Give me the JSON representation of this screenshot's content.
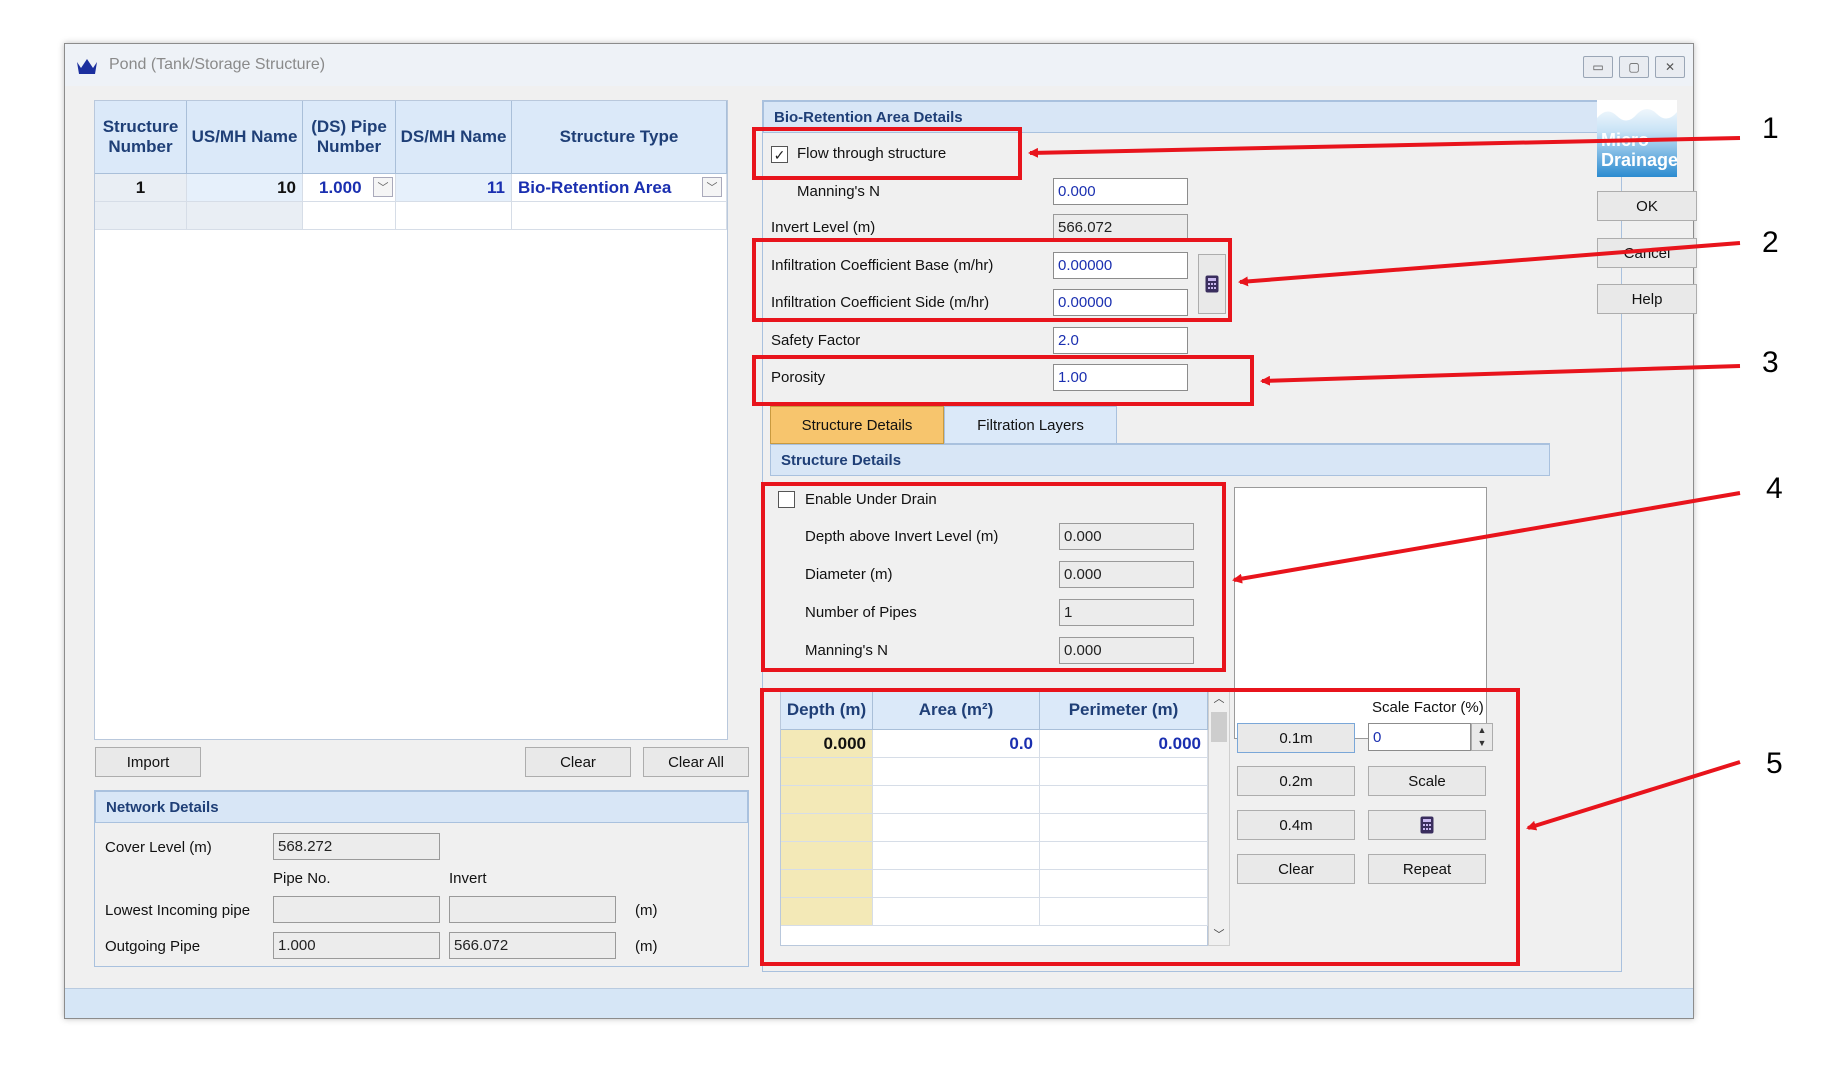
{
  "window": {
    "title": "Pond (Tank/Storage Structure)",
    "buttons": [
      "▭",
      "▢",
      "✕"
    ]
  },
  "structure_grid": {
    "headers": [
      "Structure Number",
      "US/MH Name",
      "(DS) Pipe Number",
      "DS/MH Name",
      "Structure Type"
    ],
    "row": {
      "number": "1",
      "us_mh": "10",
      "pipe": "1.000",
      "ds_mh": "11",
      "type": "Bio-Retention Area"
    }
  },
  "left_buttons": {
    "import": "Import",
    "clear": "Clear",
    "clear_all": "Clear All"
  },
  "network": {
    "title": "Network Details",
    "cover_level_label": "Cover Level (m)",
    "cover_level": "568.272",
    "pipe_no_label": "Pipe No.",
    "invert_label": "Invert",
    "lowest_label": "Lowest Incoming pipe",
    "lowest_pipe": "",
    "lowest_invert": "",
    "outgoing_label": "Outgoing Pipe",
    "outgoing_pipe": "1.000",
    "outgoing_invert": "566.072",
    "unit": "(m)"
  },
  "bio": {
    "title": "Bio-Retention Area Details",
    "flow_through_label": "Flow through structure",
    "flow_through_checked": true,
    "manning_label": "Manning's N",
    "manning": "0.000",
    "invert_label": "Invert Level (m)",
    "invert": "566.072",
    "inf_base_label": "Infiltration Coefficient Base (m/hr)",
    "inf_base": "0.00000",
    "inf_side_label": "Infiltration Coefficient Side (m/hr)",
    "inf_side": "0.00000",
    "safety_label": "Safety Factor",
    "safety": "2.0",
    "porosity_label": "Porosity",
    "porosity": "1.00"
  },
  "tabs": {
    "structure": "Structure Details",
    "filtration": "Filtration Layers"
  },
  "structure_details": {
    "title": "Structure Details",
    "under_drain_label": "Enable Under Drain",
    "depth_label": "Depth above Invert Level (m)",
    "depth": "0.000",
    "diameter_label": "Diameter (m)",
    "diameter": "0.000",
    "pipes_label": "Number of Pipes",
    "pipes": "1",
    "manning_label": "Manning's N",
    "manning": "0.000"
  },
  "depth_table": {
    "headers": [
      "Depth (m)",
      "Area (m²)",
      "Perimeter (m)"
    ],
    "row": {
      "depth": "0.000",
      "area": "0.0",
      "perimeter": "0.000"
    }
  },
  "scale": {
    "label": "Scale Factor (%)",
    "value": "0",
    "btn_01": "0.1m",
    "btn_02": "0.2m",
    "btn_04": "0.4m",
    "clear": "Clear",
    "scale": "Scale",
    "repeat": "Repeat"
  },
  "side_buttons": {
    "logo_line1": "Micro",
    "logo_line2": "Drainage",
    "ok": "OK",
    "cancel": "Cancel",
    "help": "Help"
  },
  "callouts": [
    "1",
    "2",
    "3",
    "4",
    "5"
  ],
  "colors": {
    "annotation_red": "#e8141c",
    "header_blue": "#1f3f77",
    "value_blue": "#1a2fb0"
  }
}
